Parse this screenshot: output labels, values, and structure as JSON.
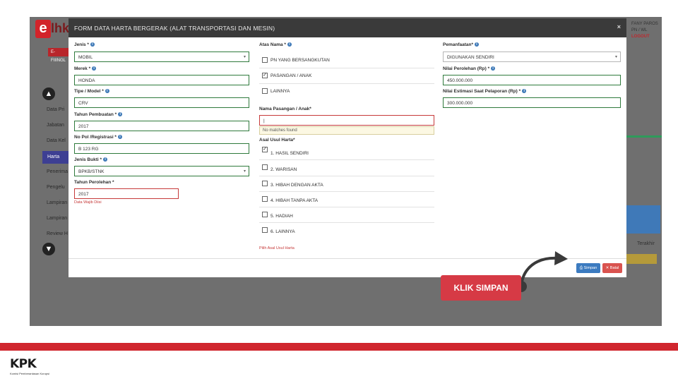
{
  "app": {
    "logo_e": "e",
    "logo_rest": "lhk",
    "header_button": "E-FIIINGL",
    "user_name": "FANY PAROS",
    "user_role": "PN / WL",
    "logout": "LOGOUT",
    "sidebar": [
      "Data Pri",
      "Jabatan",
      "Data Kel",
      "Harta",
      "Penerima",
      "Pengelu",
      "Lampiran",
      "Lampiran",
      "Review H"
    ],
    "right_tab": "Terakhir"
  },
  "modal": {
    "title": "FORM DATA HARTA BERGERAK (ALAT TRANSPORTASI DAN MESIN)",
    "close": "×",
    "col1": {
      "jenis_label": "Jenis *",
      "jenis_value": "MOBIL",
      "merek_label": "Merek *",
      "merek_value": "HONDA",
      "tipe_label": "Tipe / Model *",
      "tipe_value": "CRV",
      "tahun_label": "Tahun Pembuatan *",
      "tahun_value": "2017",
      "nopol_label": "No Pol /Registrasi *",
      "nopol_value": "B 123 RG",
      "bukti_label": "Jenis Bukti *",
      "bukti_value": "BPKB/STNK",
      "perolehan_label": "Tahun Perolehan *",
      "perolehan_value": "2017",
      "perolehan_error": "Data Wajib Diisi"
    },
    "col2": {
      "atas_nama_label": "Atas Nama *",
      "atas_nama_options": [
        "PN YANG BERSANGKUTAN",
        "PASANGAN / ANAK",
        "LAINNYA"
      ],
      "pasangan_label": "Nama Pasangan / Anak*",
      "pasangan_value": "|",
      "no_match": "No matches found",
      "asal_label": "Asal Usul Harta*",
      "asal_options": [
        "1. HASIL SENDIRI",
        "2. WARISAN",
        "3. HIBAH DENGAN AKTA",
        "4. HIBAH TANPA AKTA",
        "5. HADIAH",
        "6. LAINNYA"
      ],
      "asal_link": "Pilih Asal Usul Harta"
    },
    "col3": {
      "pemanfaatan_label": "Pemanfaatan*",
      "pemanfaatan_value": "DIGUNAKAN SENDIRI",
      "nilai_perolehan_label": "Nilai Perolehan (Rp) *",
      "nilai_perolehan_value": "450.000.000",
      "nilai_estimasi_label": "Nilai Estimasi Saat Pelaporan (Rp) *",
      "nilai_estimasi_value": "300.000.000"
    },
    "save": "Simpan",
    "cancel": "Batal"
  },
  "callout": "KLIK SIMPAN",
  "logo": {
    "name": "KPK",
    "subtitle": "Komisi Pemberantasan Korupsi"
  },
  "colors": {
    "brand_red": "#d0262e",
    "save_blue": "#3c7bc0",
    "cancel_red": "#d9534f"
  }
}
